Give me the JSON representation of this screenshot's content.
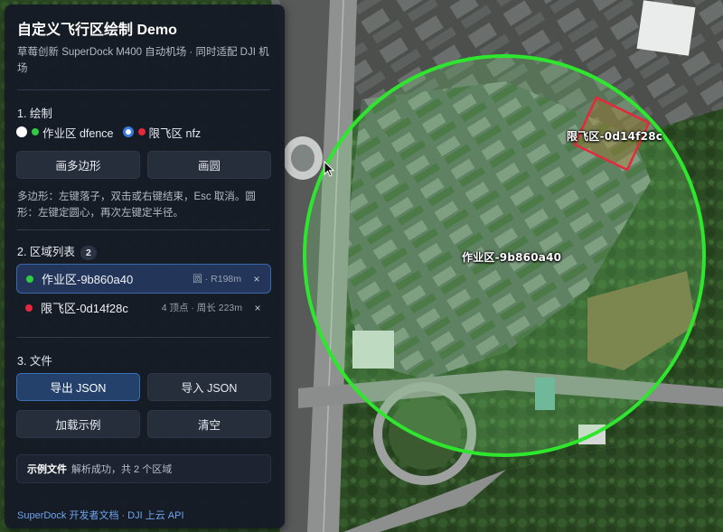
{
  "panel": {
    "title": "自定义飞行区绘制 Demo",
    "subtitle": "草莓创新 SuperDock M400 自动机场 · 同时适配 DJI 机场",
    "draw_section": "1. 绘制",
    "modes": [
      {
        "label": "作业区 dfence",
        "color": "#2ecc40",
        "checked": false
      },
      {
        "label": "限飞区 nfz",
        "color": "#e5283d",
        "checked": true
      }
    ],
    "draw_polygon_label": "画多边形",
    "draw_circle_label": "画圆",
    "help_text": "多边形：左键落子，双击或右键结束，Esc 取消。圆形：左键定圆心，再次左键定半径。",
    "list_section": "2. 区域列表",
    "zone_count": "2",
    "zones": [
      {
        "name": "作业区-9b860a40",
        "meta": "圆 · R198m",
        "color": "#2ecc40",
        "delete": "×"
      },
      {
        "name": "限飞区-0d14f28c",
        "meta": "4 顶点 · 周长 223m",
        "color": "#e5283d",
        "delete": "×"
      }
    ],
    "file_section": "3. 文件",
    "export_label": "导出 JSON",
    "import_label": "导入 JSON",
    "load_example_label": "加载示例",
    "clear_label": "清空",
    "status_strong": "示例文件",
    "status_text": "解析成功，共 2 个区域",
    "footer_link_docs": "SuperDock 开发者文档",
    "footer_sep": "·",
    "footer_link_dji": "DJI 上云 API"
  },
  "map": {
    "zone_labels": {
      "dfence": "作业区-9b860a40",
      "nfz": "限飞区-0d14f28c"
    },
    "dfence_color": "#2ee62e",
    "nfz_color": "#e5283d"
  }
}
